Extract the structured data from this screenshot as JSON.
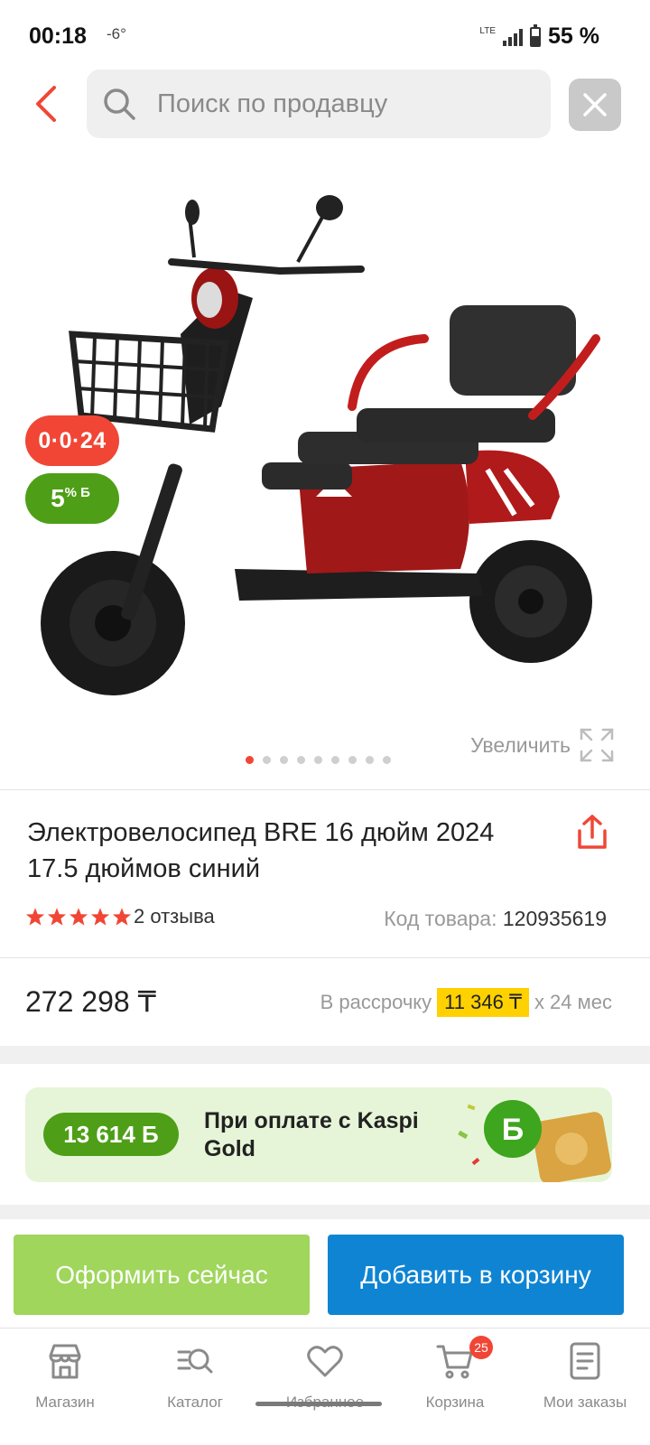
{
  "status_bar": {
    "time": "00:18",
    "temperature": "-6°",
    "network": "LTE",
    "battery_percent_text": "55 %",
    "battery_level": 0.55
  },
  "header": {
    "search_placeholder": "Поиск по продавцу",
    "back_icon": "chevron-left-icon",
    "close_icon": "close-icon"
  },
  "gallery": {
    "timer_badge": "0·0·24",
    "bonus_badge_value": "5",
    "bonus_badge_suffix": "% Б",
    "zoom_label": "Увеличить",
    "image_count": 9,
    "active_index": 0
  },
  "product": {
    "title": "Электровелосипед BRE 16 дюйм 2024 17.5 дюймов синий",
    "rating": 5,
    "reviews": "2 отзыва",
    "sku_label": "Код товара:",
    "sku_value": "120935619"
  },
  "pricing": {
    "price": "272 298 ₸",
    "installment_prefix": "В рассрочку",
    "installment_amount": "11 346 ₸",
    "installment_suffix": "х 24 мес"
  },
  "kaspi_gold": {
    "bonus": "13 614 Б",
    "text": "При оплате с Kaspi Gold"
  },
  "actions": {
    "checkout_label": "Оформить сейчас",
    "add_to_cart_label": "Добавить в корзину"
  },
  "bottom_nav": {
    "items": [
      {
        "label": "Магазин",
        "icon": "store-icon"
      },
      {
        "label": "Каталог",
        "icon": "catalog-search-icon"
      },
      {
        "label": "Избранное",
        "icon": "heart-icon"
      },
      {
        "label": "Корзина",
        "icon": "cart-icon",
        "badge": "25"
      },
      {
        "label": "Мои заказы",
        "icon": "orders-icon"
      }
    ]
  },
  "colors": {
    "accent_red": "#f14635",
    "bonus_green": "#4e9f17",
    "checkout_green": "#9fd65b",
    "cart_blue": "#0f84d3",
    "installment_yellow": "#ffd100"
  }
}
